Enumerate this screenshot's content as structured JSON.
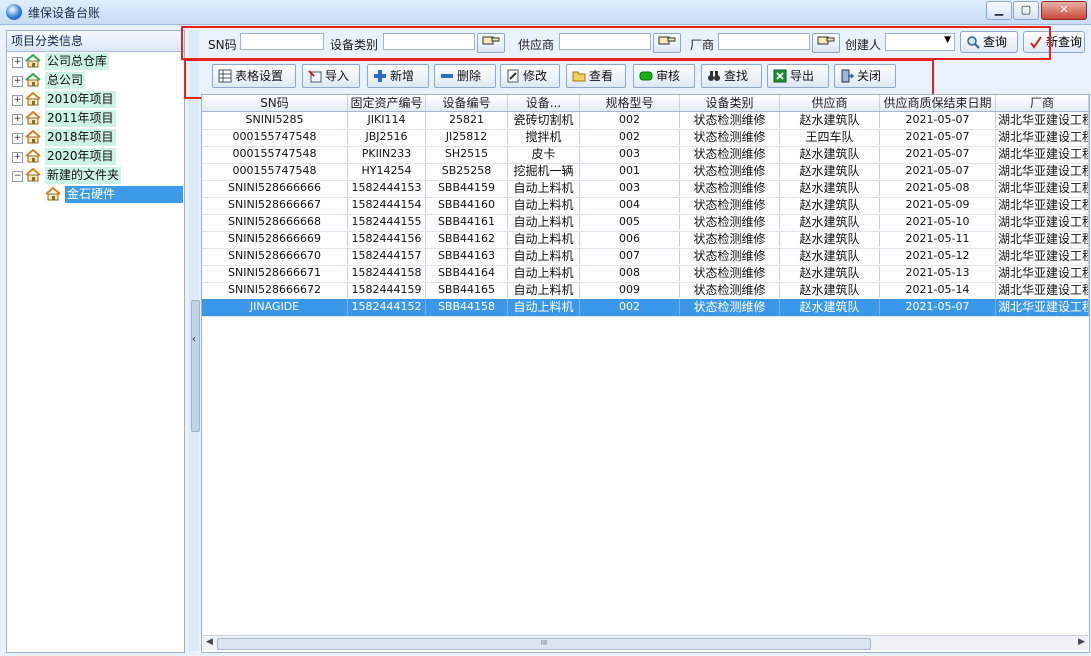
{
  "window": {
    "title": "维保设备台账",
    "controls": {
      "minimize": "▁",
      "maximize": "▢",
      "close": "✕"
    }
  },
  "left_panel": {
    "header": "项目分类信息",
    "tree": [
      {
        "label": "公司总仓库",
        "expander": "+",
        "icon": "house-green-icon"
      },
      {
        "label": "总公司",
        "expander": "+",
        "icon": "house-green-icon"
      },
      {
        "label": "2010年项目",
        "expander": "+",
        "icon": "house-orange-icon"
      },
      {
        "label": "2011年项目",
        "expander": "+",
        "icon": "house-orange-icon"
      },
      {
        "label": "2018年项目",
        "expander": "+",
        "icon": "house-orange-icon"
      },
      {
        "label": "2020年项目",
        "expander": "+",
        "icon": "house-orange-icon"
      },
      {
        "label": "新建的文件夹",
        "expander": "−",
        "icon": "house-orange-icon"
      }
    ],
    "selected_child": {
      "label": "金石硬件",
      "icon": "house-orange-icon"
    }
  },
  "search": {
    "sn_label": "SN码",
    "sn_value": "",
    "category_label": "设备类别",
    "category_value": "",
    "supplier_label": "供应商",
    "supplier_value": "",
    "maker_label": "厂商",
    "maker_value": "",
    "creator_label": "创建人",
    "creator_value": "",
    "query_button": "查询",
    "new_query_button": "新查询"
  },
  "toolbar": {
    "table_settings": "表格设置",
    "import": "导入",
    "add": "新增",
    "delete": "删除",
    "edit": "修改",
    "view": "查看",
    "audit": "审核",
    "find": "查找",
    "export": "导出",
    "close": "关闭"
  },
  "grid": {
    "columns": [
      "SN码",
      "固定资产编号",
      "设备编号",
      "设备...",
      "规格型号",
      "设备类别",
      "供应商",
      "供应商质保结束日期",
      "厂商"
    ],
    "rows": [
      [
        "SNINI5285",
        "JIKI114",
        "25821",
        "瓷砖切割机",
        "002",
        "状态检测维修",
        "赵水建筑队",
        "2021-05-07",
        "湖北华亚建设工程"
      ],
      [
        "000155747548",
        "JBJ2516",
        "JI25812",
        "搅拌机",
        "002",
        "状态检测维修",
        "王四车队",
        "2021-05-07",
        "湖北华亚建设工程"
      ],
      [
        "000155747548",
        "PKIIN233",
        "SH2515",
        "皮卡",
        "003",
        "状态检测维修",
        "赵水建筑队",
        "2021-05-07",
        "湖北华亚建设工程"
      ],
      [
        "000155747548",
        "HY14254",
        "SB25258",
        "挖掘机一辆",
        "001",
        "状态检测维修",
        "赵水建筑队",
        "2021-05-07",
        "湖北华亚建设工程"
      ],
      [
        "SNINI528666666",
        "1582444153",
        "SBB44159",
        "自动上料机",
        "003",
        "状态检测维修",
        "赵水建筑队",
        "2021-05-08",
        "湖北华亚建设工程"
      ],
      [
        "SNINI528666667",
        "1582444154",
        "SBB44160",
        "自动上料机",
        "004",
        "状态检测维修",
        "赵水建筑队",
        "2021-05-09",
        "湖北华亚建设工程"
      ],
      [
        "SNINI528666668",
        "1582444155",
        "SBB44161",
        "自动上料机",
        "005",
        "状态检测维修",
        "赵水建筑队",
        "2021-05-10",
        "湖北华亚建设工程"
      ],
      [
        "SNINI528666669",
        "1582444156",
        "SBB44162",
        "自动上料机",
        "006",
        "状态检测维修",
        "赵水建筑队",
        "2021-05-11",
        "湖北华亚建设工程"
      ],
      [
        "SNINI528666670",
        "1582444157",
        "SBB44163",
        "自动上料机",
        "007",
        "状态检测维修",
        "赵水建筑队",
        "2021-05-12",
        "湖北华亚建设工程"
      ],
      [
        "SNINI528666671",
        "1582444158",
        "SBB44164",
        "自动上料机",
        "008",
        "状态检测维修",
        "赵水建筑队",
        "2021-05-13",
        "湖北华亚建设工程"
      ],
      [
        "SNINI528666672",
        "1582444159",
        "SBB44165",
        "自动上料机",
        "009",
        "状态检测维修",
        "赵水建筑队",
        "2021-05-14",
        "湖北华亚建设工程"
      ],
      [
        "JINAGIDE",
        "1582444152",
        "SBB44158",
        "自动上料机",
        "002",
        "状态检测维修",
        "赵水建筑队",
        "2021-05-07",
        "湖北华亚建设工程"
      ]
    ],
    "selected_row_index": 11,
    "scroll_thumb_label": "III"
  },
  "colors": {
    "selection": "#3b97ea",
    "tree_highlight": "#cdf3e4",
    "annotation_red": "#e8231f"
  }
}
